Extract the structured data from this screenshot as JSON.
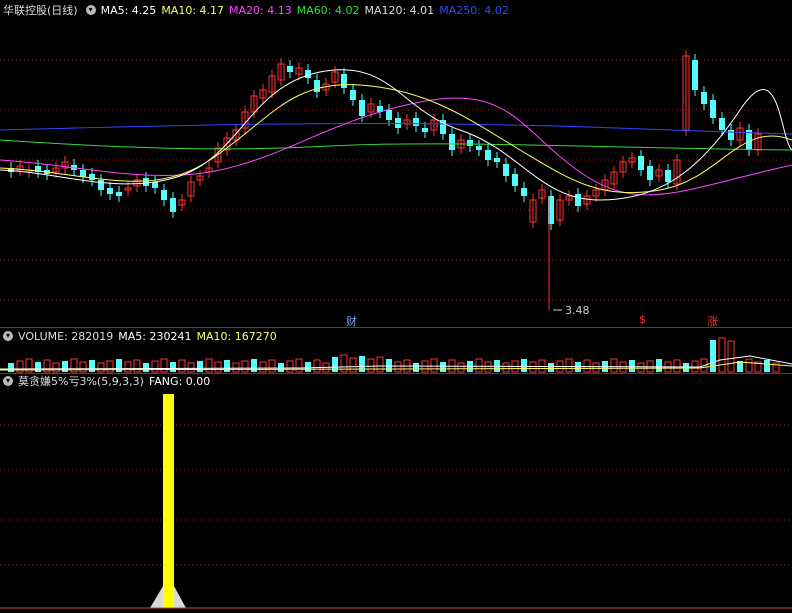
{
  "price_panel": {
    "title": "华联控股(日线)",
    "ma": [
      {
        "label": "MA5: 4.25",
        "color": "#ffffff"
      },
      {
        "label": "MA10: 4.17",
        "color": "#ffff66"
      },
      {
        "label": "MA20: 4.13",
        "color": "#ff44ff"
      },
      {
        "label": "MA60: 4.02",
        "color": "#33dd33"
      },
      {
        "label": "MA120: 4.01",
        "color": "#dddddd"
      },
      {
        "label": "MA250: 4.02",
        "color": "#3344ff"
      }
    ],
    "low_label": "3.48",
    "markers": {
      "cai": "财",
      "dollar": "$",
      "zhang": "涨"
    }
  },
  "volume_panel": {
    "label": "VOLUME: 282019",
    "ma5": "MA5: 230241",
    "ma10": "MA10: 167270"
  },
  "indicator_panel": {
    "name": "莫贪嫌5%亏3%(5,9,3,3)",
    "fang": "FANG: 0.00"
  },
  "colors": {
    "up": "#ff3232",
    "down": "#54fcfc",
    "bg": "#000000",
    "grid": "#a02020"
  },
  "icons": {
    "panel_toggle": "circle-arrow-icon"
  }
}
